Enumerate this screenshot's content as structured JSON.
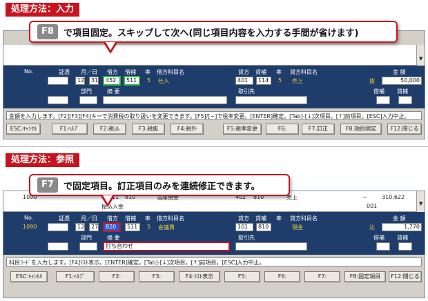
{
  "top": {
    "method_tag": "処理方法：入力",
    "callout": {
      "key": "F8",
      "text": "で項目固定。スキップして次へ(同じ項目内容を入力する手間が省けます)"
    },
    "labels": {
      "no": "No.",
      "voucher": "証憑",
      "month_day": "月／日",
      "debit_code": "借方",
      "debit_sub": "借補",
      "rate": "率",
      "debit_account_name": "借方科目名",
      "credit_code": "貸方",
      "credit_sub": "貸補",
      "rate2": "率",
      "credit_account_name": "貸方科目名",
      "amount": "金 額",
      "dept": "部門",
      "memo": "摘 要",
      "client": "取引先",
      "debit_aux": "借補",
      "credit_aux": "貸補"
    },
    "values": {
      "month": "12",
      "day": "31",
      "debit_code": "452",
      "debit_sub": "511",
      "debit_rate": "5",
      "debit_account": "仕入",
      "credit_code": "401",
      "credit_sub": "114",
      "credit_rate": "5",
      "credit_account": "売上",
      "tax_flag": "抜",
      "amount": "50,000"
    },
    "status_text": "金額を入力します。[F2][F3][F4]キーで消費税の取り扱いを変更できます。[F5]/[−]で税率変更。[ENTER]確定。[Tab]-[↓]次項目。[↑]前項目。[ESC]入力中止。",
    "fkeys": [
      "ESC:ｷｬﾝｾﾙ",
      "F1:ﾍﾙﾌﾟ",
      "F2:税込",
      "F3:税抜",
      "F4:税外",
      "F5:税率変更",
      "F6:",
      "F7:訂正",
      "F8:項目固定",
      "F12:閉じる"
    ]
  },
  "bottom": {
    "method_tag": "処理方法：参照",
    "callout": {
      "key": "F7",
      "text": "で固定項目。訂正項目のみを連続修正できます。"
    },
    "prev_row": {
      "no": "1090",
      "code1": "111",
      "code2": "810",
      "name1": "当座預金",
      "code3": "402",
      "code4": "810",
      "name2": "売上",
      "dash": "−",
      "amount": "310,622",
      "sub_no": "001",
      "memo": "振込入金"
    },
    "labels": {
      "no": "No.",
      "voucher": "証憑",
      "month_day": "月／日",
      "debit_code": "借方",
      "debit_sub": "借補",
      "rate": "率",
      "debit_account_name": "借方科目名",
      "credit_code": "貸方",
      "credit_sub": "貸補",
      "rate2": "率",
      "credit_account_name": "貸方科目名",
      "amount": "金 額",
      "dept": "部門",
      "memo": "摘 要",
      "client": "取引先",
      "debit_aux": "借補",
      "credit_aux": "貸補"
    },
    "values": {
      "no": "1090",
      "month": "12",
      "day": "27",
      "debit_code": "820",
      "debit_sub": "511",
      "debit_rate": "5",
      "debit_account": "会議費",
      "credit_code": "101",
      "credit_sub": "810",
      "credit_account": "現金",
      "tax_flag": "込",
      "amount": "1,770",
      "memo": "打ち合わせ"
    },
    "status_text": "科目ｺｰﾄﾞを入力します。[F4]ﾘｽﾄ表示。[ENTER]確定。[Tab]-[↓]次項目。[↑]前項目。[ESC]入力中止。",
    "fkeys": [
      "ESC:ｷｬﾝｾﾙ",
      "F1:ﾍﾙﾌﾟ",
      "F2:",
      "F3:",
      "F4:ﾘｽﾄ表示",
      "F5:",
      "F6:",
      "F7:",
      "F8:固定項目",
      "F12:閉じる"
    ]
  }
}
